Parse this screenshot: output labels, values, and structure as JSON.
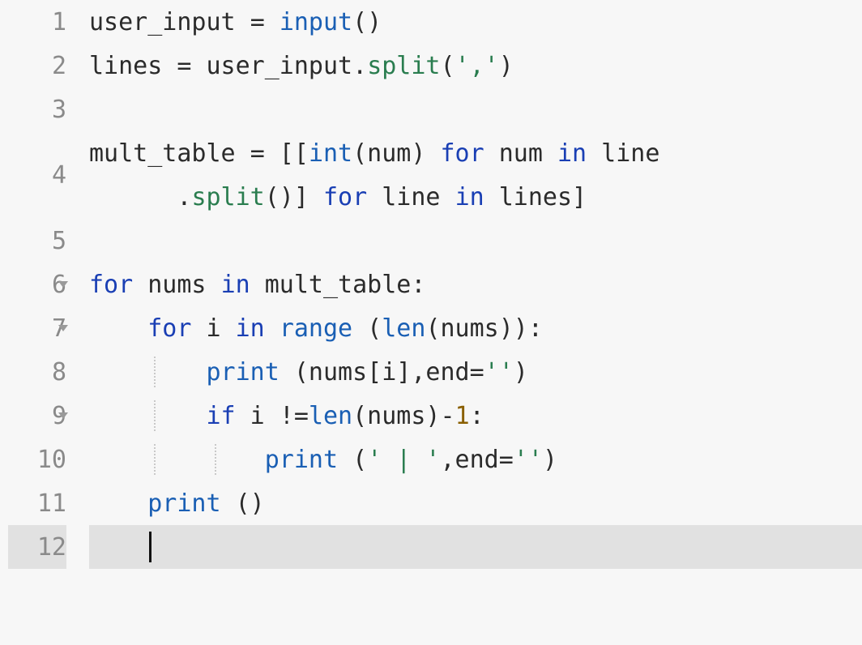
{
  "editor": {
    "gutter": {
      "1": "1",
      "2": "2",
      "3": "3",
      "4": "4",
      "5": "5",
      "6": "6",
      "7": "7",
      "8": "8",
      "9": "9",
      "10": "10",
      "11": "11",
      "12": "12"
    },
    "active_line": 12,
    "code": {
      "l1": {
        "t0": "user_input ",
        "t1": "=",
        "t2": " ",
        "t3": "input",
        "t4": "()"
      },
      "l2": {
        "t0": "lines ",
        "t1": "=",
        "t2": " user_input.",
        "t3": "split",
        "t4": "(",
        "t5": "','",
        "t6": ")"
      },
      "l3": {
        "t0": ""
      },
      "l4a": {
        "t0": "mult_table ",
        "t1": "=",
        "t2": " [[",
        "t3": "int",
        "t4": "(num) ",
        "t5": "for",
        "t6": " num ",
        "t7": "in",
        "t8": " line"
      },
      "l4b": {
        "indent": "      ",
        "t0": ".",
        "t1": "split",
        "t2": "()] ",
        "t3": "for",
        "t4": " line ",
        "t5": "in",
        "t6": " lines]"
      },
      "l5": {
        "t0": ""
      },
      "l6": {
        "t0": "for",
        "t1": " nums ",
        "t2": "in",
        "t3": " mult_table:"
      },
      "l7": {
        "indent": "    ",
        "t0": "for",
        "t1": " i ",
        "t2": "in",
        "t3": " ",
        "t4": "range",
        "t5": " (",
        "t6": "len",
        "t7": "(nums)):"
      },
      "l8": {
        "indent": "        ",
        "t0": "print",
        "t1": " (nums[i],end",
        "t2": "=",
        "t3": "''",
        "t4": ")"
      },
      "l9": {
        "indent": "        ",
        "t0": "if",
        "t1": " i ",
        "t2": "!=",
        "t3": "len",
        "t4": "(nums)",
        "t5": "-",
        "t6": "1",
        "t7": ":"
      },
      "l10": {
        "indent": "            ",
        "t0": "print",
        "t1": " (",
        "t2": "' | '",
        "t3": ",end",
        "t4": "=",
        "t5": "''",
        "t6": ")"
      },
      "l11": {
        "indent": "    ",
        "t0": "print",
        "t1": " ()"
      },
      "l12": {
        "indent": "    ",
        "t0": ""
      }
    }
  }
}
